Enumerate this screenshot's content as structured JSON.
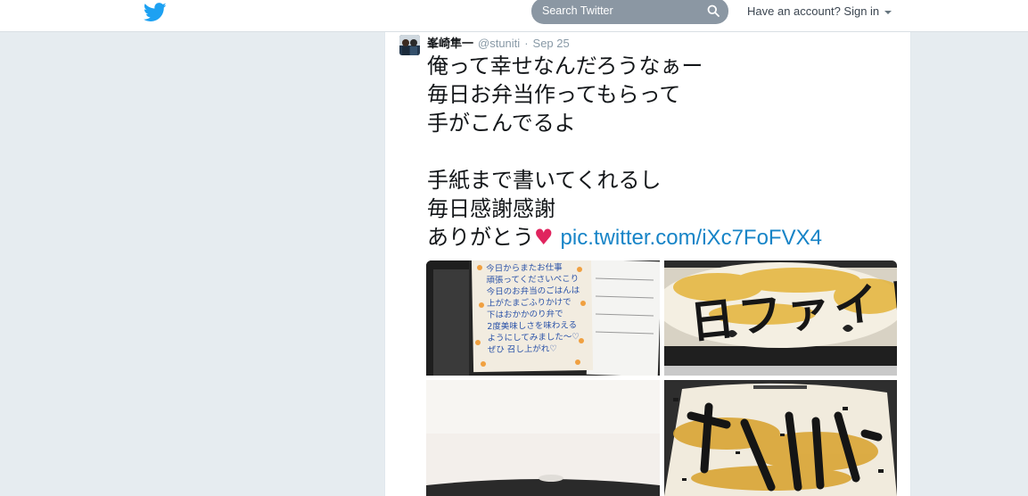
{
  "header": {
    "logo": "twitter-bird-icon",
    "search_placeholder": "Search Twitter",
    "signin_label": "Have an account? Sign in"
  },
  "tweet": {
    "name": "峯崎隼一",
    "handle": "@stuniti",
    "separator": "·",
    "date": "Sep 25",
    "lines": [
      "俺って幸せなんだろうなぁー",
      "毎日お弁当作ってもらって",
      "手がこんでるよ",
      "",
      "手紙まで書いてくれるし",
      "毎日感謝感謝",
      "ありがとう"
    ],
    "heart": "♥",
    "link": "pic.twitter.com/iXc7FoFVX4",
    "photos": {
      "note_lines": [
        "今日からまたお仕事",
        "頑張ってくださいぺこり",
        "今日のお弁当のごはんは",
        "上がたまごふりかけで",
        "下はおかかのり弁で",
        "2度美味しさを味わえる",
        "ようにしてみました～♡",
        "ぜひ 召し上がれ♡"
      ],
      "bento_text": "日ファイト"
    }
  },
  "colors": {
    "brand": "#1da1f2",
    "link": "#1784c7",
    "heart": "#e0245e",
    "background": "#e6ecf0"
  }
}
